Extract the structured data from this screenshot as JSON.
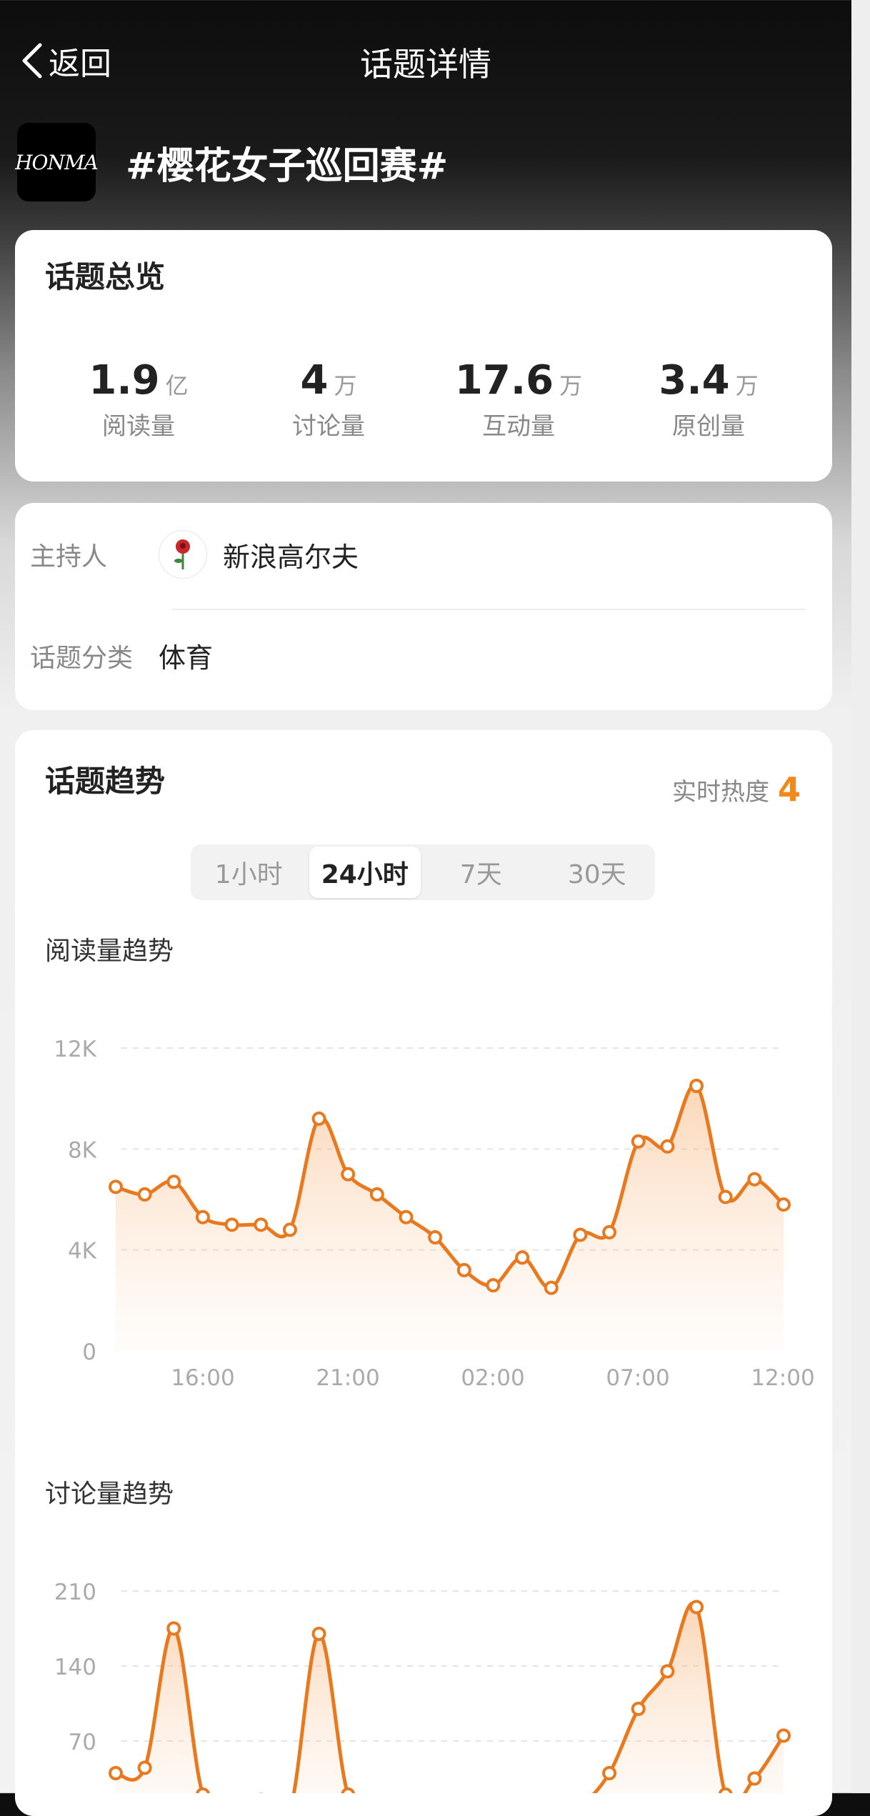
{
  "header": {
    "back_label": "返回",
    "title": "话题详情"
  },
  "topic": {
    "logo_text": "HONMA",
    "name": "#樱花女子巡回赛#"
  },
  "overview": {
    "title": "话题总览",
    "stats": [
      {
        "num": "1.9",
        "unit": "亿",
        "label": "阅读量"
      },
      {
        "num": "4",
        "unit": "万",
        "label": "讨论量"
      },
      {
        "num": "17.6",
        "unit": "万",
        "label": "互动量"
      },
      {
        "num": "3.4",
        "unit": "万",
        "label": "原创量"
      }
    ]
  },
  "info": {
    "host_label": "主持人",
    "host_name": "新浪高尔夫",
    "category_label": "话题分类",
    "category_value": "体育"
  },
  "trend": {
    "title": "话题趋势",
    "heat_label": "实时热度",
    "heat_value": "4",
    "tabs": [
      "1小时",
      "24小时",
      "7天",
      "30天"
    ],
    "active_tab": "24小时",
    "read_title": "阅读量趋势",
    "discuss_title": "讨论量趋势"
  },
  "colors": {
    "accent": "#f08a1d",
    "line": "#e8791f"
  },
  "chart_data": [
    {
      "type": "area",
      "title": "阅读量趋势",
      "x_ticks": [
        "16:00",
        "21:00",
        "02:00",
        "07:00",
        "12:00"
      ],
      "y_ticks": [
        "12K",
        "8K",
        "4K",
        "0"
      ],
      "ylim": [
        0,
        12000
      ],
      "values": [
        6500,
        6200,
        6700,
        5300,
        5000,
        5000,
        4800,
        9200,
        7000,
        6200,
        5300,
        4500,
        3200,
        2600,
        3700,
        2500,
        4600,
        4700,
        8300,
        8100,
        10500,
        6100,
        6800,
        5800
      ],
      "grid": true
    },
    {
      "type": "area",
      "title": "讨论量趋势",
      "y_ticks": [
        "210",
        "140",
        "70"
      ],
      "ylim": [
        0,
        210
      ],
      "values": [
        40,
        45,
        175,
        20,
        10,
        15,
        5,
        170,
        20,
        10,
        5,
        5,
        5,
        5,
        5,
        5,
        10,
        40,
        100,
        135,
        195,
        20,
        35,
        75
      ],
      "grid": true
    }
  ]
}
